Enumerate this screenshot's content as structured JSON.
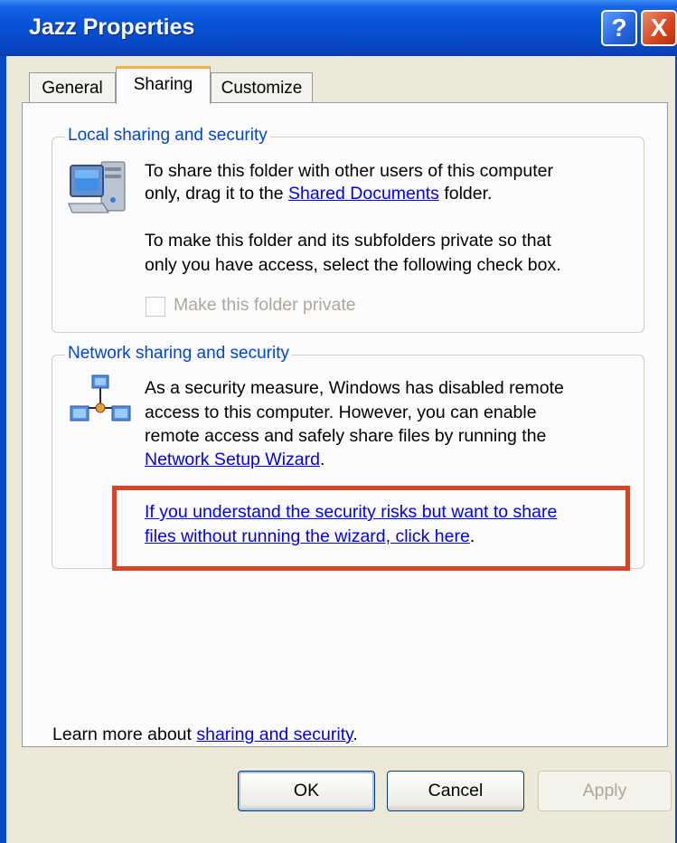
{
  "window": {
    "title": "Jazz Properties"
  },
  "titlebar": {
    "help_label": "?",
    "close_label": "X"
  },
  "tabs": [
    {
      "label": "General",
      "selected": false
    },
    {
      "label": "Sharing",
      "selected": true
    },
    {
      "label": "Customize",
      "selected": false
    }
  ],
  "local_sharing": {
    "legend": "Local sharing and security",
    "line1": "To share this folder with other users of this computer",
    "line2_prefix": "only, drag it to the ",
    "link": "Shared Documents",
    "line2_suffix": " folder.",
    "line3": "To make this folder and its subfolders private so that",
    "line4": "only you have access, select the following check box.",
    "checkbox_label": "Make this folder private",
    "checkbox_checked": false,
    "checkbox_enabled": false
  },
  "network_sharing": {
    "legend": "Network sharing and security",
    "line1": "As a security measure, Windows has disabled remote",
    "line2": "access to this computer. However, you can enable",
    "line3": "remote access and safely share files by running the",
    "wizard_link": "Network Setup Wizard",
    "wizard_suffix": ".",
    "risk_link_line1": "If you understand the security risks but want to share",
    "risk_link_line2": "files without running the wizard, click here",
    "risk_suffix": "."
  },
  "learn_more": {
    "prefix": "Learn more about ",
    "link": "sharing and security",
    "suffix": "."
  },
  "buttons": {
    "ok": "OK",
    "cancel": "Cancel",
    "apply": "Apply",
    "apply_enabled": false
  },
  "colors": {
    "titlebar": "#0853d8",
    "link": "#0000ee",
    "legend": "#0046d5",
    "highlight": "#d64527"
  }
}
